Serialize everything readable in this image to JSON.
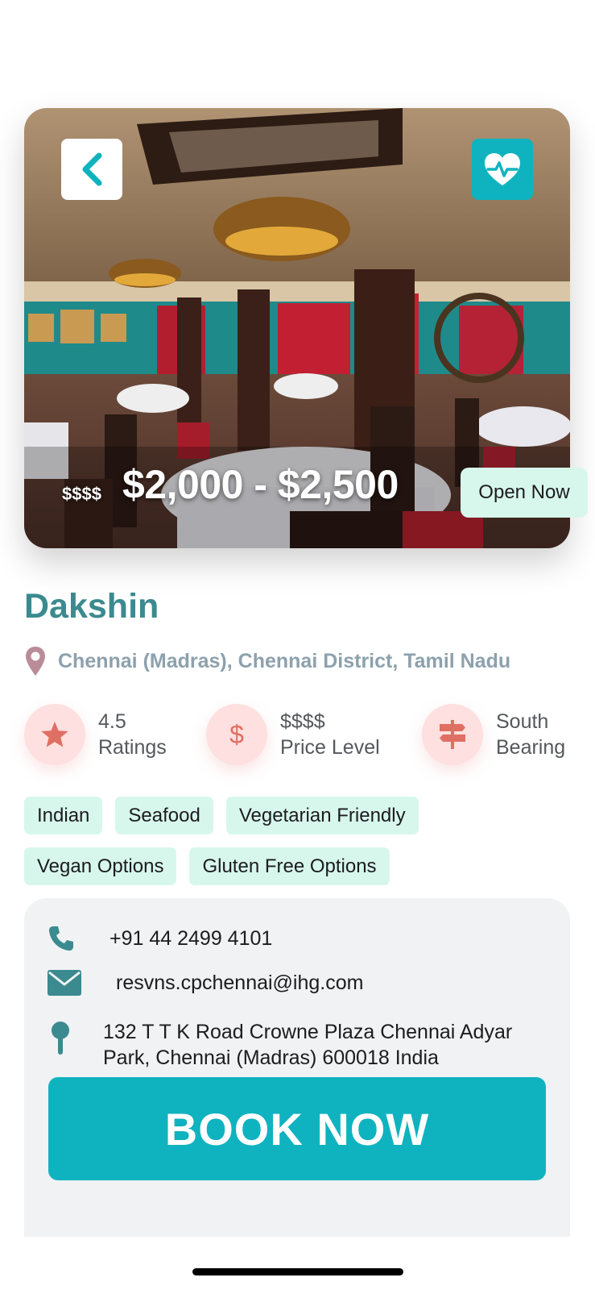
{
  "hero": {
    "price_symbol": "$$$$",
    "price_range": "$2,000 - $2,500",
    "open_status": "Open Now"
  },
  "restaurant": {
    "name": "Dakshin",
    "location": "Chennai (Madras), Chennai District, Tamil Nadu"
  },
  "stats": [
    {
      "icon": "star-icon",
      "value": "4.5",
      "label": "Ratings"
    },
    {
      "icon": "dollar-icon",
      "value": "$$$$",
      "label": "Price Level"
    },
    {
      "icon": "signpost-icon",
      "value": "South",
      "label": "Bearing"
    }
  ],
  "tags": [
    "Indian",
    "Seafood",
    "Vegetarian Friendly",
    "Vegan Options",
    "Gluten Free Options"
  ],
  "contact": {
    "phone": "+91 44 2499 4101",
    "email": "resvns.cpchennai@ihg.com",
    "address_line1": "132 T T K Road Crowne Plaza Chennai Adyar",
    "address_line2": "Park, Chennai (Madras) 600018 India"
  },
  "book_button": "BOOK NOW",
  "colors": {
    "accent": "#0fb3bf",
    "title": "#3b8a8f",
    "tag_bg": "#d8f7ec",
    "stat_bg": "#fde0df",
    "stat_icon": "#e06f63"
  }
}
